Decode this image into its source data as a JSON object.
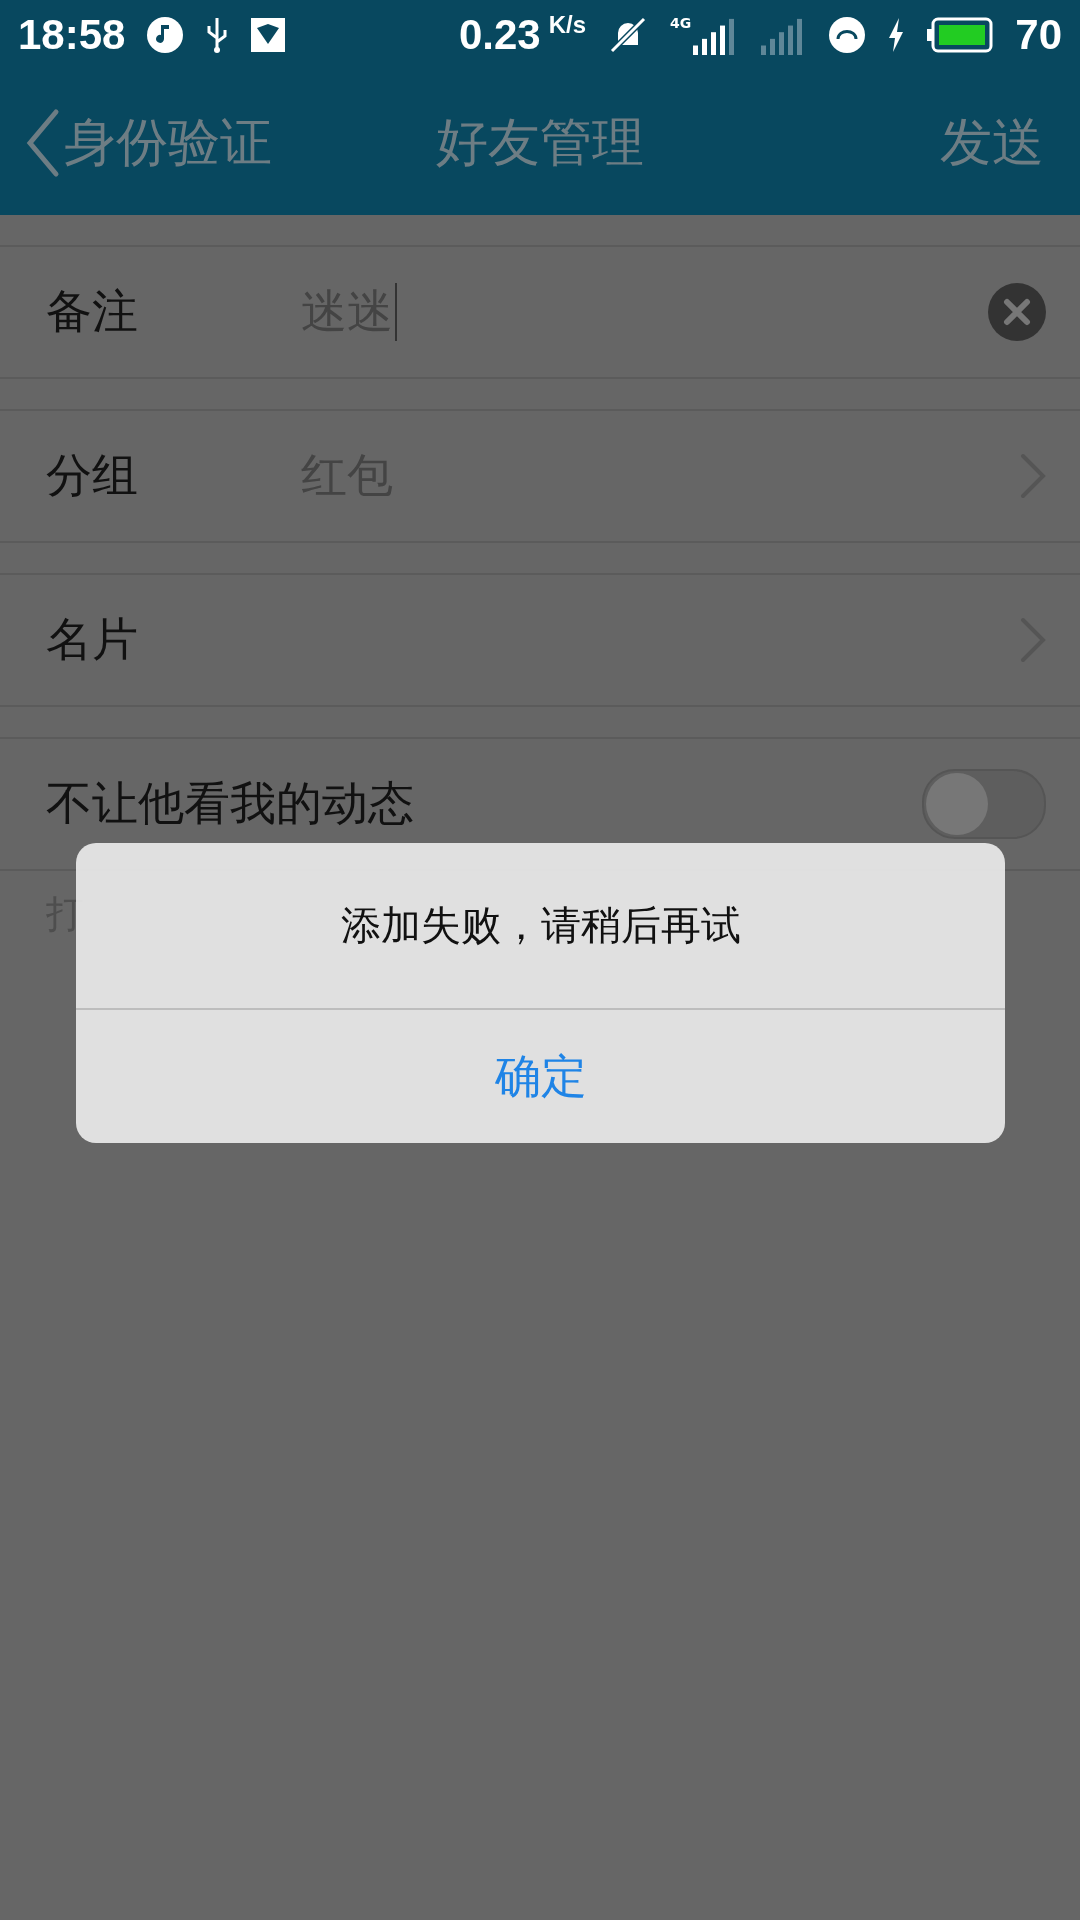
{
  "status_bar": {
    "time": "18:58",
    "speed": "0.23",
    "speed_unit": "K/s",
    "network": "4G",
    "battery": "70"
  },
  "nav": {
    "back": "身份验证",
    "title": "好友管理",
    "action": "发送"
  },
  "rows": [
    {
      "kind": "input",
      "label": "备注",
      "value": "迷迷"
    },
    {
      "kind": "link",
      "label": "分组",
      "value": "红包"
    },
    {
      "kind": "link",
      "label": "名片"
    },
    {
      "kind": "switch",
      "label": "不让他看我的动态",
      "on": false,
      "hint": "打"
    }
  ],
  "dialog": {
    "message": "添加失败，请稍后再试",
    "button": "确定"
  }
}
